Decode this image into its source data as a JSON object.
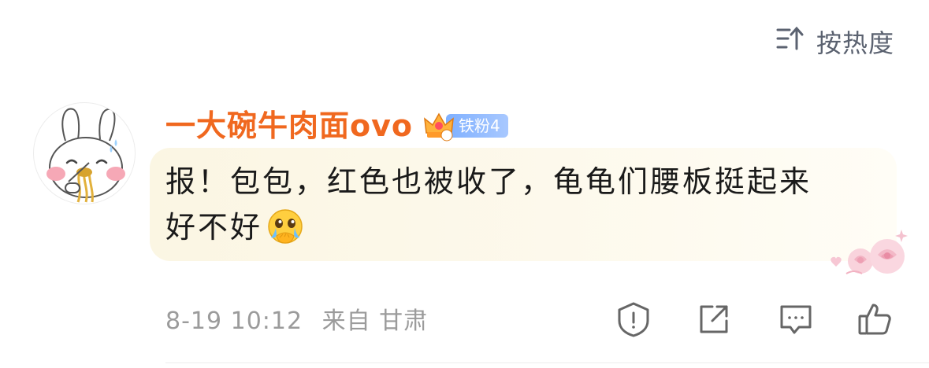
{
  "sort": {
    "label": "按热度",
    "icon": "sort-icon"
  },
  "comment": {
    "username": "一大碗牛肉面ovo",
    "badge": {
      "label": "铁粉4",
      "crown_level": "1"
    },
    "text_line1": "报！包包，红色也被收了，龟龟们腰板挺起来",
    "text_line2": "好不好",
    "emoji": "crying-face-emoji",
    "date": "8-19 10:12",
    "source": "来自 甘肃"
  },
  "actions": {
    "report": "report-icon",
    "share": "share-icon",
    "comment": "comment-icon",
    "like": "like-icon"
  },
  "colors": {
    "username": "#f0681f",
    "badge": "#7fb0ff",
    "meta": "#9b9b9b",
    "bubble": "#fbf6e3"
  }
}
